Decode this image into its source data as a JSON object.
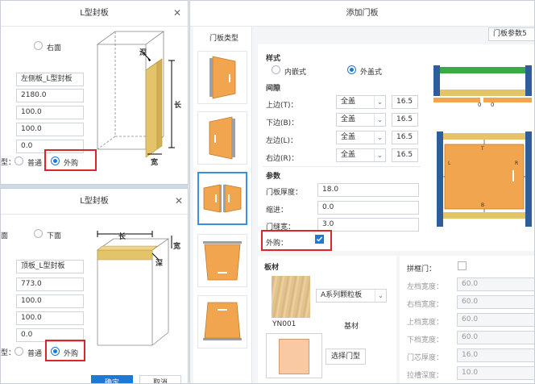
{
  "window1": {
    "title": "L型封板",
    "radio_left": "右面",
    "fields": [
      "左侧板_L型封板",
      "2180.0",
      "100.0",
      "100.0",
      "0.0"
    ],
    "type_label": "型：",
    "opt_normal": "普通",
    "opt_outsource": "外购",
    "dim_depth": "深",
    "dim_length": "长",
    "dim_width": "宽"
  },
  "window2": {
    "title": "L型封板",
    "radio_left": "面",
    "radio_right": "下面",
    "fields": [
      "顶板_L型封板",
      "773.0",
      "100.0",
      "100.0",
      "0.0"
    ],
    "type_label": "型：",
    "opt_normal": "普通",
    "opt_outsource": "外购",
    "dim_length": "长",
    "dim_width": "宽",
    "dim_depth": "深",
    "ok": "确定",
    "cancel": "取消"
  },
  "main": {
    "title": "添加门板",
    "door_type_label": "门板类型",
    "param_select": "门板参数5",
    "style_section": "样式",
    "style_inner": "内嵌式",
    "style_outer": "外盖式",
    "gap_section": "间隙",
    "gaps": [
      {
        "label": "上边(T)：",
        "mode": "全盖",
        "value": "16.5"
      },
      {
        "label": "下边(B)：",
        "mode": "全盖",
        "value": "16.5"
      },
      {
        "label": "左边(L)：",
        "mode": "全盖",
        "value": "16.5"
      },
      {
        "label": "右边(R)：",
        "mode": "全盖",
        "value": "16.5"
      }
    ],
    "param_section": "参数",
    "params": [
      {
        "label": "门板厚度：",
        "value": "18.0"
      },
      {
        "label": "缩进：",
        "value": "0.0"
      },
      {
        "label": "门缝宽：",
        "value": "3.0"
      }
    ],
    "outsource_label": "外购：",
    "material_section": "板材",
    "material_select": "A系列颗粒板",
    "material_code": "YN001",
    "material_base": "基材",
    "select_door_btn": "选择门型",
    "diagram_zero_left": "0",
    "diagram_zero_right": "0",
    "diagram_T": "T",
    "diagram_B": "B",
    "diagram_L": "L",
    "diagram_R": "R",
    "frame_door_label": "拼框门：",
    "frame_fields": [
      {
        "label": "左档宽度：",
        "value": "60.0"
      },
      {
        "label": "右档宽度：",
        "value": "60.0"
      },
      {
        "label": "上档宽度：",
        "value": "60.0"
      },
      {
        "label": "下档宽度：",
        "value": "60.0"
      },
      {
        "label": "门芯厚度：",
        "value": "16.0"
      },
      {
        "label": "拉槽深度：",
        "value": "10.0"
      }
    ]
  },
  "colors": {
    "door_orange": "#f0a54e",
    "frame_blue": "#2e5d9c",
    "board_yellow": "#e4c46a",
    "green_top": "#3aaa45",
    "accent": "#1e78d6",
    "highlight_red": "#d9262c"
  }
}
